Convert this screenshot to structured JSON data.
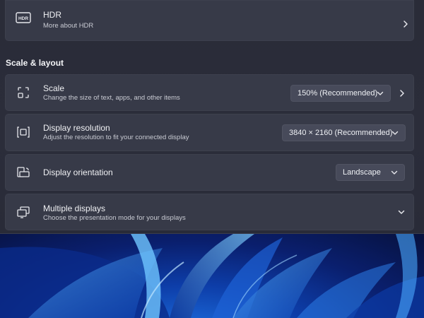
{
  "hdr": {
    "icon": "hdr-icon",
    "icon_text": "HDR",
    "title": "HDR",
    "subtitle": "More about HDR"
  },
  "section": {
    "title": "Scale & layout"
  },
  "scale": {
    "icon": "scale-icon",
    "title": "Scale",
    "subtitle": "Change the size of text, apps, and other items",
    "value": "150% (Recommended)"
  },
  "resolution": {
    "icon": "resolution-icon",
    "title": "Display resolution",
    "subtitle": "Adjust the resolution to fit your connected display",
    "value": "3840 × 2160 (Recommended)"
  },
  "orientation": {
    "icon": "orientation-icon",
    "title": "Display orientation",
    "value": "Landscape"
  },
  "multiple": {
    "icon": "multiple-displays-icon",
    "title": "Multiple displays",
    "subtitle": "Choose the presentation mode for your displays"
  },
  "colors": {
    "panel": "#2a2c38",
    "card": "#373a48",
    "dropdown": "#474a5a",
    "wallpaper_blue": "#1d6fe0"
  }
}
